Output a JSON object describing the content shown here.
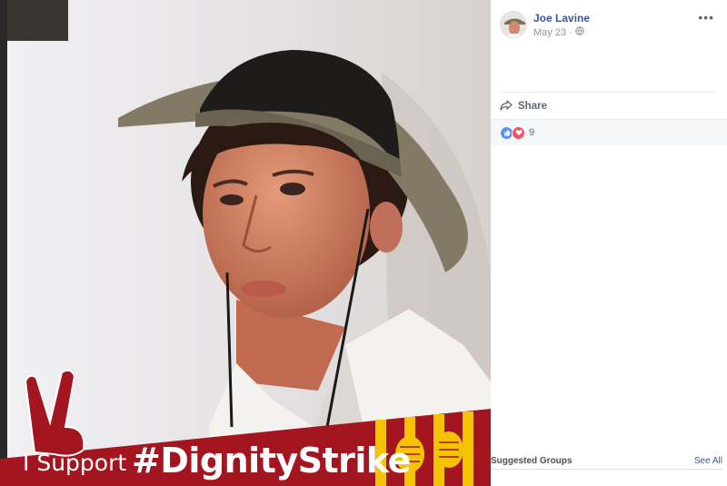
{
  "post": {
    "author": "Joe Lavine",
    "date": "May 23",
    "privacy_icon": "globe-icon",
    "more_icon": "more-options-icon"
  },
  "photo": {
    "banner_left": "I Support",
    "banner_hashtag": "#DignityStrike"
  },
  "actions": {
    "share_label": "Share",
    "share_icon": "share-arrow-icon"
  },
  "reactions": {
    "count": "9",
    "types": [
      "like-icon",
      "love-icon"
    ]
  },
  "sidebar": {
    "suggested_title": "Suggested Groups",
    "see_all": "See All"
  },
  "colors": {
    "link": "#365899",
    "banner_red": "#a3151f",
    "banner_yellow": "#f5c400"
  }
}
